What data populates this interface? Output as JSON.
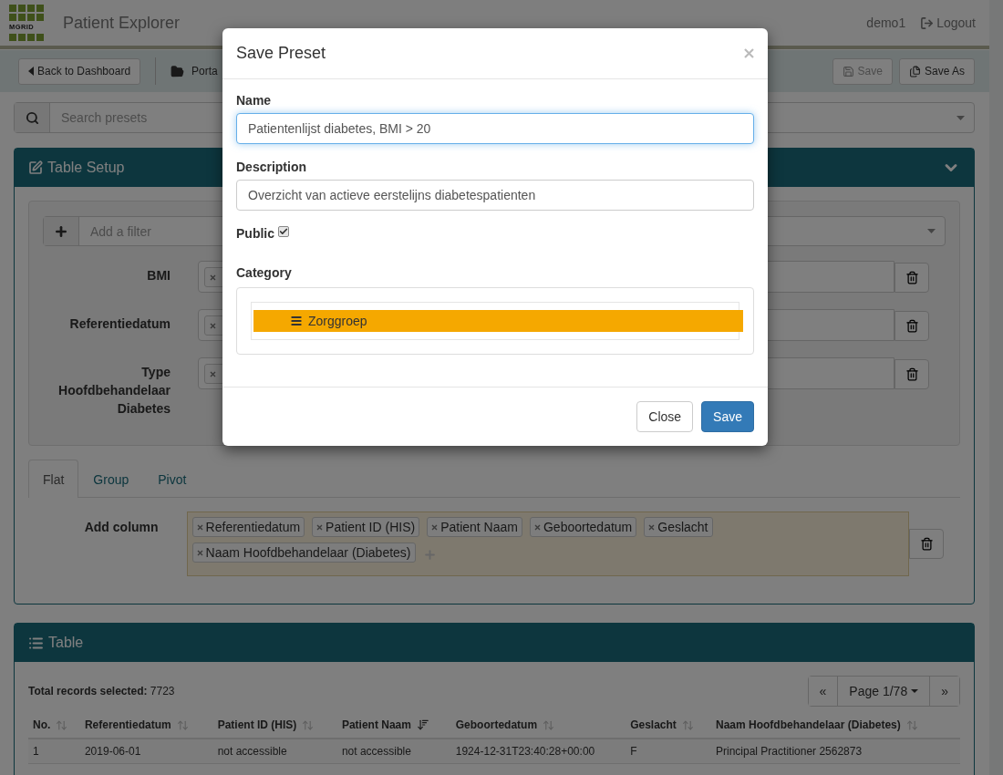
{
  "header": {
    "logo_text": "MGRID",
    "title": "Patient Explorer",
    "user": "demo1",
    "logout": "Logout"
  },
  "toolbar": {
    "back": "Back to Dashboard",
    "portal": "Porta",
    "save": {
      "label": "Save",
      "disabled": true
    },
    "save_as": {
      "label": "Save As",
      "disabled": false
    }
  },
  "search": {
    "placeholder": "Search presets"
  },
  "table_setup": {
    "title": "Table Setup",
    "filter_placeholder": "Add a filter",
    "filters": [
      {
        "label": "BMI"
      },
      {
        "label": "Referentiedatum"
      },
      {
        "label": "Type Hoofdbehandelaar Diabetes"
      }
    ],
    "tabs": [
      {
        "label": "Flat",
        "selected": true
      },
      {
        "label": "Group",
        "selected": false
      },
      {
        "label": "Pivot",
        "selected": false
      }
    ],
    "add_column": {
      "label": "Add column",
      "chips": [
        "Referentiedatum",
        "Patient ID (HIS)",
        "Patient Naam",
        "Geboortedatum",
        "Geslacht",
        "Naam Hoofdbehandelaar (Diabetes)"
      ]
    }
  },
  "table": {
    "title": "Table",
    "total_label": "Total records selected:",
    "total": "7723",
    "pagination": {
      "first": "«",
      "page": "Page 1/78",
      "last": "»"
    },
    "columns": [
      {
        "label": "No.",
        "sorted": false
      },
      {
        "label": "Referentiedatum",
        "sorted": false
      },
      {
        "label": "Patient ID (HIS)",
        "sorted": false
      },
      {
        "label": "Patient Naam",
        "sorted": true
      },
      {
        "label": "Geboortedatum",
        "sorted": false
      },
      {
        "label": "Geslacht",
        "sorted": false
      },
      {
        "label": "Naam Hoofdbehandelaar (Diabetes)",
        "sorted": false
      }
    ],
    "rows": [
      [
        "1",
        "2019-06-01",
        "not accessible",
        "not accessible",
        "1924-12-31T23:40:28+00:00",
        "F",
        "Principal Practitioner 2562873"
      ]
    ]
  },
  "dialog": {
    "title": "Save Preset",
    "name_label": "Name",
    "name_value": "Patientenlijst diabetes, BMI > 20",
    "description_label": "Description",
    "description_value": "Overzicht van actieve eerstelijns diabetespatienten",
    "public_label": "Public",
    "public_checked": true,
    "category_label": "Category",
    "categories": [
      {
        "label": "Zorggroep",
        "selected": true
      }
    ],
    "buttons": [
      {
        "label": "Close",
        "kind": "default"
      },
      {
        "label": "Save",
        "kind": "primary"
      }
    ]
  }
}
